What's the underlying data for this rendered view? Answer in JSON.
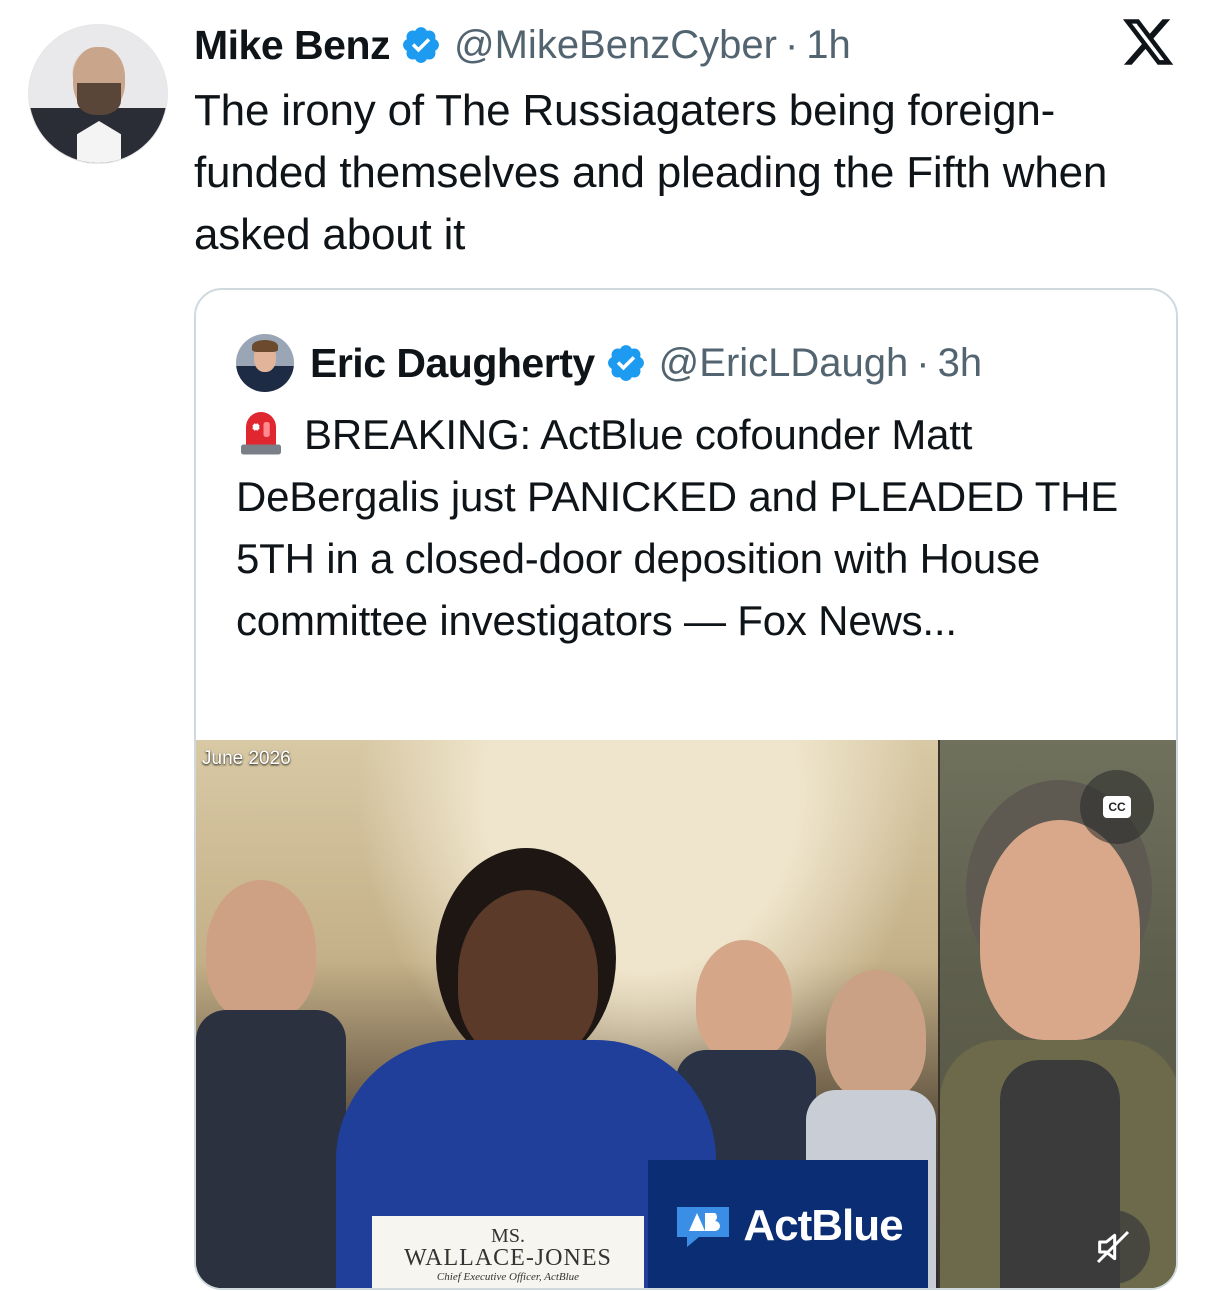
{
  "tweet": {
    "author_name": "Mike Benz",
    "author_handle": "@MikeBenzCyber",
    "separator": "·",
    "time": "1h",
    "text": "The irony of The Russiagaters being foreign-funded themselves and pleading the Fifth when asked about it"
  },
  "quote": {
    "author_name": "Eric Daugherty",
    "author_handle": "@EricLDaugh",
    "separator": "·",
    "time": "3h",
    "text": "BREAKING: ActBlue cofounder Matt DeBergalis just PANICKED and PLEADED THE 5TH in a closed-door deposition with House committee investigators — Fox News..."
  },
  "media": {
    "date_label": "June 2026",
    "nameplate_ms": "MS.",
    "nameplate_name": "WALLACE-JONES",
    "nameplate_title": "Chief Executive Officer, ActBlue",
    "brand": "ActBlue",
    "cc_label": "CC"
  },
  "colors": {
    "verified": "#1d9bf0",
    "secondary_text": "#536471",
    "border": "#cfd9de",
    "actblue_bg": "#0a2d74"
  },
  "icons": [
    "verified-badge-icon",
    "x-logo-icon",
    "siren-emoji-icon",
    "cc-icon",
    "mute-icon",
    "actblue-logo-icon"
  ]
}
